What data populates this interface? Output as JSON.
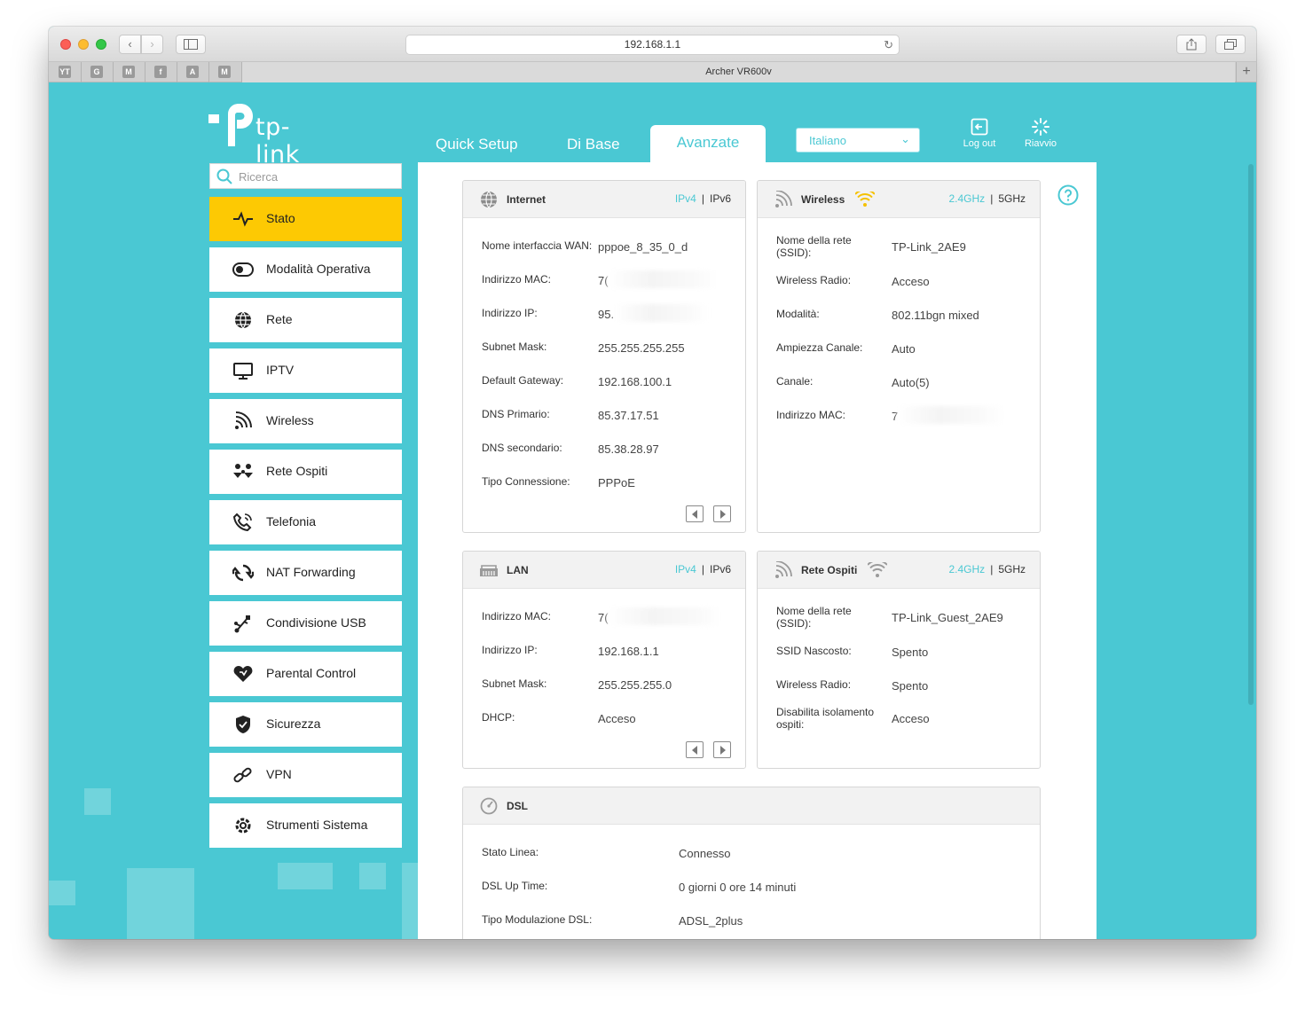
{
  "browser": {
    "url": "192.168.1.1",
    "tab_title": "Archer VR600v",
    "favorites": [
      "YT",
      "G",
      "M",
      "f",
      "A",
      "M"
    ]
  },
  "brand": {
    "logo_text": "tp-link"
  },
  "topnav": {
    "tabs": [
      "Quick Setup",
      "Di Base",
      "Avanzate"
    ],
    "active": "Avanzate",
    "language": "Italiano",
    "logout": "Log out",
    "reboot": "Riavvio"
  },
  "search": {
    "placeholder": "Ricerca"
  },
  "menu": [
    {
      "label": "Stato",
      "icon": "pulse-icon",
      "active": true
    },
    {
      "label": "Modalità Operativa",
      "icon": "toggle-icon"
    },
    {
      "label": "Rete",
      "icon": "globe-icon"
    },
    {
      "label": "IPTV",
      "icon": "monitor-icon"
    },
    {
      "label": "Wireless",
      "icon": "wireless-icon"
    },
    {
      "label": "Rete Ospiti",
      "icon": "guests-icon"
    },
    {
      "label": "Telefonia",
      "icon": "phone-icon"
    },
    {
      "label": "NAT Forwarding",
      "icon": "nat-icon"
    },
    {
      "label": "Condivisione USB",
      "icon": "usb-icon"
    },
    {
      "label": "Parental Control",
      "icon": "heart-icon"
    },
    {
      "label": "Sicurezza",
      "icon": "shield-icon"
    },
    {
      "label": "VPN",
      "icon": "link-icon"
    },
    {
      "label": "Strumenti Sistema",
      "icon": "gear-icon"
    }
  ],
  "protocols": {
    "ipv4": "IPv4",
    "ipv6": "IPv6",
    "ghz24": "2.4GHz",
    "ghz5": "5GHz"
  },
  "internet": {
    "title": "Internet",
    "rows": [
      {
        "label": "Nome interfaccia WAN:",
        "value": "pppoe_8_35_0_d"
      },
      {
        "label": "Indirizzo MAC:",
        "value": "7("
      },
      {
        "label": "Indirizzo IP:",
        "value": "95."
      },
      {
        "label": "Subnet Mask:",
        "value": "255.255.255.255"
      },
      {
        "label": "Default Gateway:",
        "value": "192.168.100.1"
      },
      {
        "label": "DNS Primario:",
        "value": "85.37.17.51"
      },
      {
        "label": "DNS secondario:",
        "value": "85.38.28.97"
      },
      {
        "label": "Tipo Connessione:",
        "value": "PPPoE"
      }
    ]
  },
  "wireless": {
    "title": "Wireless",
    "rows": [
      {
        "label": "Nome della rete (SSID):",
        "value": "TP-Link_2AE9"
      },
      {
        "label": "Wireless Radio:",
        "value": "Acceso"
      },
      {
        "label": "Modalità:",
        "value": "802.11bgn mixed"
      },
      {
        "label": "Ampiezza Canale:",
        "value": "Auto"
      },
      {
        "label": "Canale:",
        "value": "Auto(5)"
      },
      {
        "label": "Indirizzo MAC:",
        "value": "7"
      }
    ]
  },
  "lan": {
    "title": "LAN",
    "rows": [
      {
        "label": "Indirizzo MAC:",
        "value": "7("
      },
      {
        "label": "Indirizzo IP:",
        "value": "192.168.1.1"
      },
      {
        "label": "Subnet Mask:",
        "value": "255.255.255.0"
      },
      {
        "label": "DHCP:",
        "value": "Acceso"
      }
    ]
  },
  "guest": {
    "title": "Rete Ospiti",
    "rows": [
      {
        "label": "Nome della rete (SSID):",
        "value": "TP-Link_Guest_2AE9"
      },
      {
        "label": "SSID Nascosto:",
        "value": "Spento"
      },
      {
        "label": "Wireless Radio:",
        "value": "Spento"
      },
      {
        "label": "Disabilita isolamento ospiti:",
        "value": "Acceso"
      }
    ]
  },
  "dsl": {
    "title": "DSL",
    "rows": [
      {
        "label": "Stato Linea:",
        "value": "Connesso"
      },
      {
        "label": "DSL Up Time:",
        "value": "0 giorni 0 ore 14 minuti"
      },
      {
        "label": "Tipo Modulazione DSL:",
        "value": "ADSL_2plus"
      }
    ]
  },
  "colors": {
    "accent": "#4ac8d3",
    "active_menu": "#fdc903",
    "wifi_on": "#f5c100",
    "wifi_off": "#9a9a9a"
  }
}
